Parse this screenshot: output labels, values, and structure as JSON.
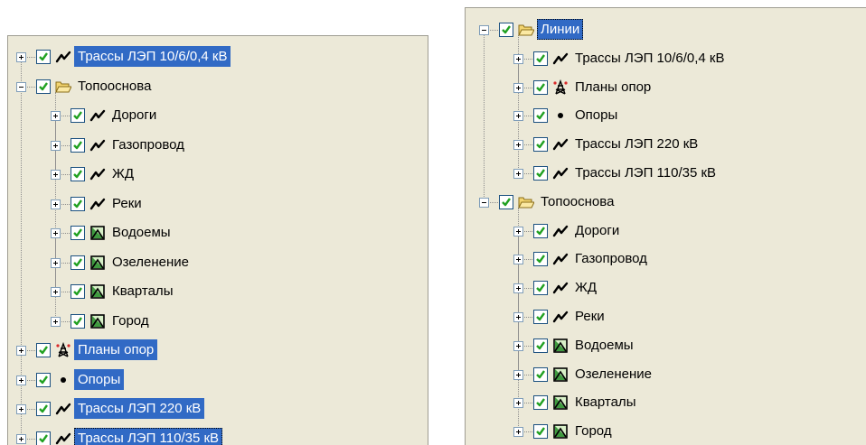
{
  "left_tree": {
    "items": [
      {
        "label": "Трассы ЛЭП 10/6/0,4 кВ",
        "icon": "line-layer-icon",
        "level": 0,
        "expander": "plus",
        "selected": true
      },
      {
        "label": "Топооснова",
        "icon": "folder-open-icon",
        "level": 0,
        "expander": "minus",
        "selected": false
      },
      {
        "label": "Дороги",
        "icon": "line-layer-icon",
        "level": 1,
        "expander": "plus",
        "selected": false
      },
      {
        "label": "Газопровод",
        "icon": "line-layer-icon",
        "level": 1,
        "expander": "plus",
        "selected": false
      },
      {
        "label": "ЖД",
        "icon": "line-layer-icon",
        "level": 1,
        "expander": "plus",
        "selected": false
      },
      {
        "label": "Реки",
        "icon": "line-layer-icon",
        "level": 1,
        "expander": "plus",
        "selected": false
      },
      {
        "label": "Водоемы",
        "icon": "polygon-layer-icon",
        "level": 1,
        "expander": "plus",
        "selected": false
      },
      {
        "label": "Озеленение",
        "icon": "polygon-layer-icon",
        "level": 1,
        "expander": "plus",
        "selected": false
      },
      {
        "label": "Кварталы",
        "icon": "polygon-layer-icon",
        "level": 1,
        "expander": "plus",
        "selected": false
      },
      {
        "label": "Город",
        "icon": "polygon-layer-icon",
        "level": 1,
        "expander": "plus",
        "selected": false
      },
      {
        "label": "Планы опор",
        "icon": "tower-plan-icon",
        "level": 0,
        "expander": "plus",
        "selected": true
      },
      {
        "label": "Опоры",
        "icon": "point-layer-icon",
        "level": 0,
        "expander": "plus",
        "selected": true
      },
      {
        "label": "Трассы ЛЭП 220 кВ",
        "icon": "line-layer-icon",
        "level": 0,
        "expander": "plus",
        "selected": true
      },
      {
        "label": "Трассы ЛЭП 110/35 кВ",
        "icon": "line-layer-icon",
        "level": 0,
        "expander": "plus",
        "selected": true,
        "focused": true
      }
    ]
  },
  "right_tree": {
    "items": [
      {
        "label": "Линии",
        "icon": "folder-open-icon",
        "level": 0,
        "expander": "minus",
        "selected": true,
        "focused": true
      },
      {
        "label": "Трассы ЛЭП 10/6/0,4 кВ",
        "icon": "line-layer-icon",
        "level": 1,
        "expander": "plus",
        "selected": false
      },
      {
        "label": "Планы опор",
        "icon": "tower-plan-icon",
        "level": 1,
        "expander": "plus",
        "selected": false
      },
      {
        "label": "Опоры",
        "icon": "point-layer-icon",
        "level": 1,
        "expander": "plus",
        "selected": false
      },
      {
        "label": "Трассы ЛЭП 220 кВ",
        "icon": "line-layer-icon",
        "level": 1,
        "expander": "plus",
        "selected": false
      },
      {
        "label": "Трассы ЛЭП 110/35 кВ",
        "icon": "line-layer-icon",
        "level": 1,
        "expander": "plus",
        "selected": false
      },
      {
        "label": "Топооснова",
        "icon": "folder-open-icon",
        "level": 0,
        "expander": "minus",
        "selected": false
      },
      {
        "label": "Дороги",
        "icon": "line-layer-icon",
        "level": 1,
        "expander": "plus",
        "selected": false
      },
      {
        "label": "Газопровод",
        "icon": "line-layer-icon",
        "level": 1,
        "expander": "plus",
        "selected": false
      },
      {
        "label": "ЖД",
        "icon": "line-layer-icon",
        "level": 1,
        "expander": "plus",
        "selected": false
      },
      {
        "label": "Реки",
        "icon": "line-layer-icon",
        "level": 1,
        "expander": "plus",
        "selected": false
      },
      {
        "label": "Водоемы",
        "icon": "polygon-layer-icon",
        "level": 1,
        "expander": "plus",
        "selected": false
      },
      {
        "label": "Озеленение",
        "icon": "polygon-layer-icon",
        "level": 1,
        "expander": "plus",
        "selected": false
      },
      {
        "label": "Кварталы",
        "icon": "polygon-layer-icon",
        "level": 1,
        "expander": "plus",
        "selected": false
      },
      {
        "label": "Город",
        "icon": "polygon-layer-icon",
        "level": 1,
        "expander": "plus",
        "selected": false
      }
    ]
  },
  "colors": {
    "panel_background": "#ece9d8",
    "selection": "#316ac5",
    "checkmark": "#21a121"
  }
}
